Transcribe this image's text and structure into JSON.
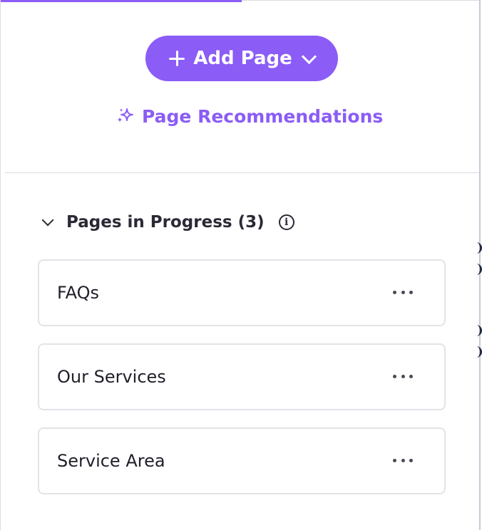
{
  "toolbar": {
    "add_page_label": "Add Page",
    "recommendations_label": "Page Recommendations"
  },
  "section": {
    "title": "Pages in Progress (3)",
    "info_glyph": "i"
  },
  "pages": [
    {
      "name": "FAQs"
    },
    {
      "name": "Our Services"
    },
    {
      "name": "Service Area"
    }
  ],
  "icons": {
    "add": "plus-icon",
    "dropdown": "chevron-down-icon",
    "recommend": "sparkle-icon",
    "collapse": "chevron-down-icon",
    "info": "info-icon",
    "more": "more-horizontal-icon"
  },
  "colors": {
    "accent": "#8b5cf6",
    "text": "#2a2a36",
    "border": "#e3e3e8"
  }
}
